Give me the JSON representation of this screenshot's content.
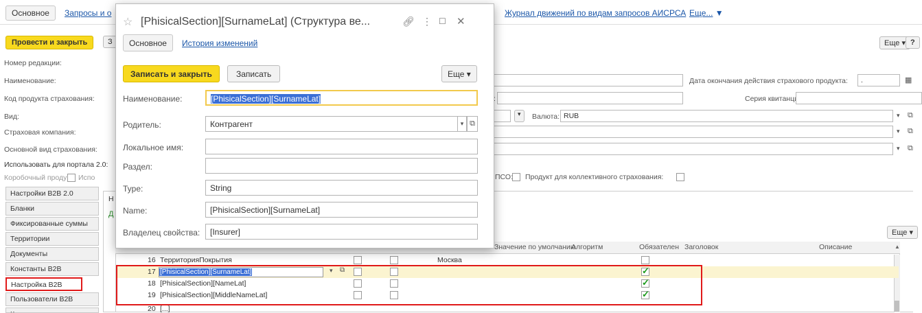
{
  "topbar": {
    "tab_main": "Основное",
    "links": [
      "Запросы и о",
      "Журнал движений по видам запросов АИСРСА",
      "Еще..."
    ],
    "more_arrow": "▼"
  },
  "toolbar": {
    "post_close": "Провести и закрыть",
    "btn3": "З",
    "more": "Еще",
    "help": "?"
  },
  "form": {
    "edition_no": "Номер редакции:",
    "name": "Наименование:",
    "product_code": "Код продукта страхования:",
    "kind": "Вид:",
    "insurer": "Страховая компания:",
    "main_kind": "Основной вид страхования:",
    "use_portal": "Использовать для портала 2.0:",
    "boxed": "Коробочный продукт:",
    "use_short": "Испо",
    "end_date_label": "Дата окончания действия страхового продукта:",
    "end_date_value": ".",
    "receipt_series": "Серия квитанции:",
    "colon": ":",
    "currency_label": "Валюта:",
    "currency_value": "RUB",
    "pso": "ПСО:",
    "collective": "Продукт для коллективного страхования:"
  },
  "sidetabs": [
    "Настройки B2B 2.0",
    "Бланки",
    "Фиксированные суммы",
    "Территории",
    "Документы",
    "Константы B2B",
    "Настройка B2B",
    "Пользователи B2B",
    "Кандидаты"
  ],
  "panel": {
    "tab_h": "Н",
    "link_d": "Д",
    "more": "Еще"
  },
  "grid": {
    "headers": [
      "Значение по умолчанию",
      "Алгоритм",
      "Обязателен",
      "Заголовок",
      "Описание"
    ],
    "rows": [
      {
        "n": "16",
        "name": "ТерриторияПокрытия",
        "default": "Москва",
        "req": false
      },
      {
        "n": "17",
        "name": "[PhisicalSection][SurnameLat]",
        "default": "",
        "req": true
      },
      {
        "n": "18",
        "name": "[PhisicalSection][NameLat]",
        "default": "",
        "req": true
      },
      {
        "n": "19",
        "name": "[PhisicalSection][MiddleNameLat]",
        "default": "",
        "req": true
      },
      {
        "n": "20",
        "name": "[...]",
        "default": "",
        "req": false
      }
    ]
  },
  "modal": {
    "title": "[PhisicalSection][SurnameLat] (Структура ве...",
    "tabs": [
      "Основное",
      "История изменений"
    ],
    "save_close": "Записать и закрыть",
    "save": "Записать",
    "more": "Еще",
    "fields": [
      {
        "label": "Наименование:",
        "value": "[PhisicalSection][SurnameLat]"
      },
      {
        "label": "Родитель:",
        "value": "Контрагент"
      },
      {
        "label": "Локальное имя:",
        "value": ""
      },
      {
        "label": "Раздел:",
        "value": ""
      },
      {
        "label": "Type:",
        "value": "String"
      },
      {
        "label": "Name:",
        "value": "[PhisicalSection][SurnameLat]"
      },
      {
        "label": "Владелец свойства:",
        "value": "[Insurer]"
      }
    ]
  },
  "colors": {
    "accent_yellow": "#f8d91e",
    "link": "#1a56a8",
    "highlight_red": "#e01919",
    "select_blue": "#3b6fd6"
  }
}
